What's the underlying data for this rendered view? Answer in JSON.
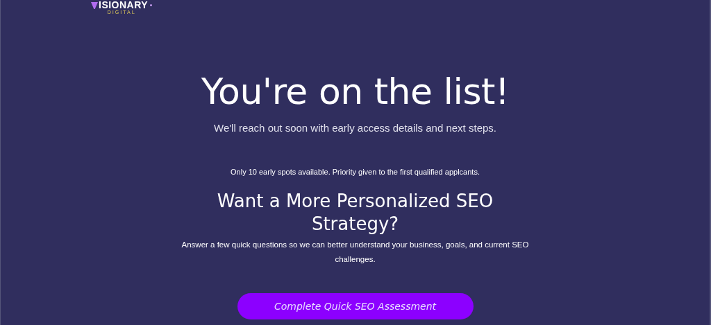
{
  "logo": {
    "text": "ISIONARY",
    "subtext": "DIGITAL"
  },
  "heading": "You're on the list!",
  "subtitle": "We'll reach out soon with early access details and next steps.",
  "notice": "Only 10 early spots available. Priority given to the first qualified applcants.",
  "cta_heading": "Want a More Personalized SEO Strategy?",
  "cta_text": "Answer a few quick questions so we can better understand your business, goals, and current SEO challenges.",
  "button": "Complete Quick SEO Assessment"
}
